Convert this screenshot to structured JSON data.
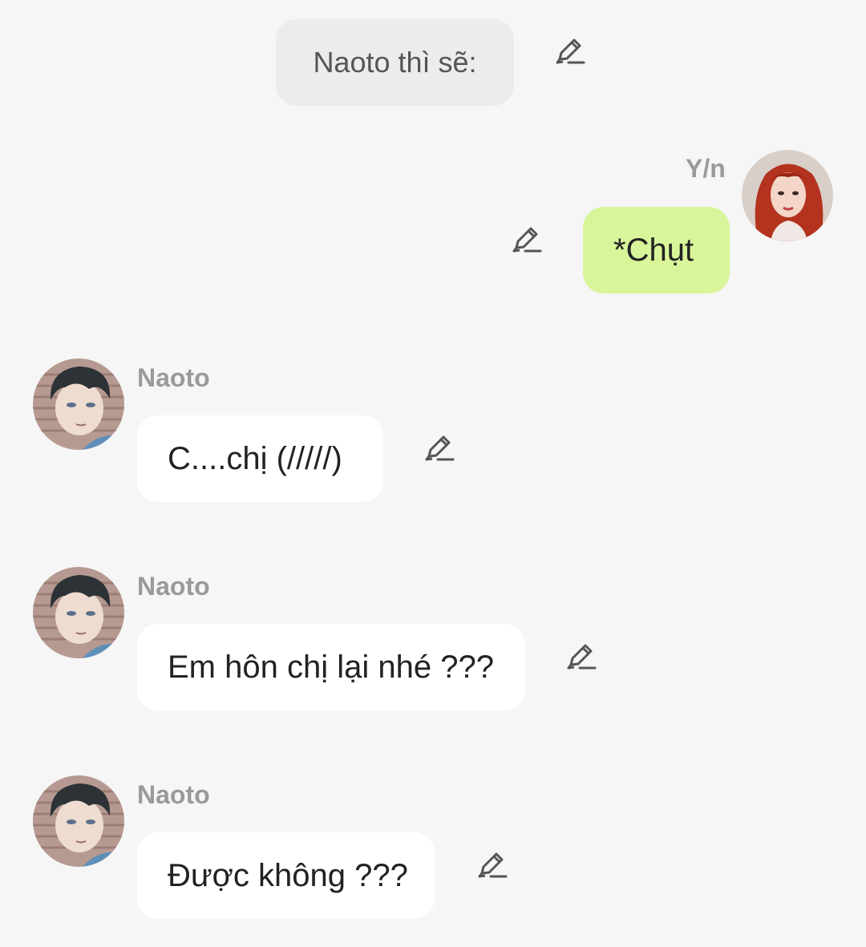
{
  "narration": {
    "text": "Naoto thì sẽ:"
  },
  "icons": {
    "edit": "pencil-edit-icon"
  },
  "colors": {
    "background": "#f6f6f6",
    "narration_bubble": "#ececec",
    "my_bubble": "#d9f59a",
    "other_bubble": "#ffffff",
    "sender_name": "#9a9a9a"
  },
  "messages": [
    {
      "sender": "Y/n",
      "text": "*Chụt",
      "side": "right"
    },
    {
      "sender": "Naoto",
      "text": "C....chị (/////)",
      "side": "left"
    },
    {
      "sender": "Naoto",
      "text": "Em hôn chị lại nhé ???",
      "side": "left"
    },
    {
      "sender": "Naoto",
      "text": "Được không ???",
      "side": "left"
    }
  ]
}
